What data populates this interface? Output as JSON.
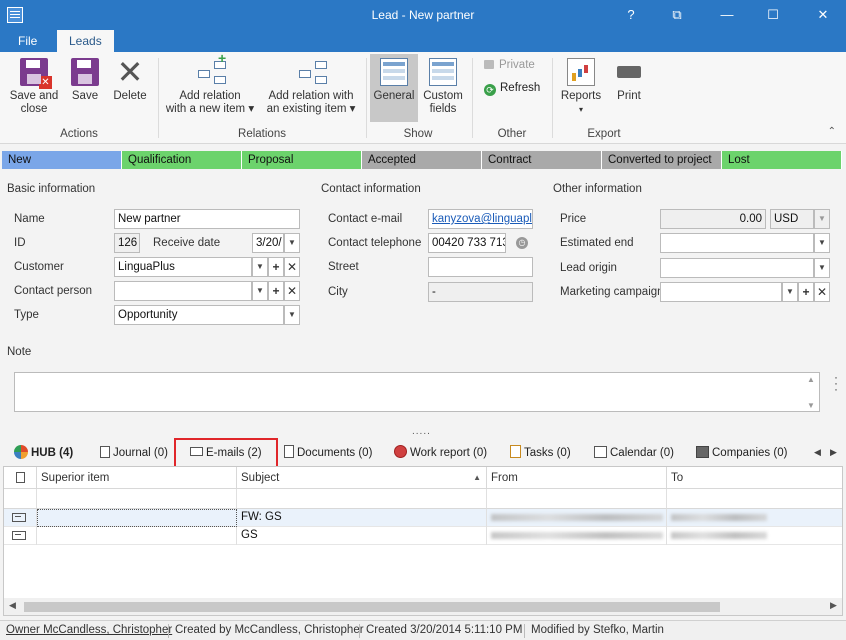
{
  "window": {
    "title": "Lead - New partner",
    "help": "?",
    "restore": "⧉",
    "minimize": "—",
    "maximize": "☐",
    "close": "✕"
  },
  "menu": {
    "file": "File",
    "leads": "Leads"
  },
  "ribbon": {
    "save_close": [
      "Save and",
      "close"
    ],
    "save": "Save",
    "delete": "Delete",
    "add_relation_new": [
      "Add relation",
      "with a new item ▾"
    ],
    "add_relation_existing": [
      "Add relation with",
      "an existing item ▾"
    ],
    "general": "General",
    "custom_fields": [
      "Custom",
      "fields"
    ],
    "private": "Private",
    "refresh": "Refresh",
    "reports": "Reports",
    "reports_arrow": "▾",
    "print": "Print",
    "groups": {
      "actions": "Actions",
      "relations": "Relations",
      "show": "Show",
      "other": "Other",
      "export": "Export"
    }
  },
  "stages": [
    {
      "label": "New",
      "color": "#7aa6e8"
    },
    {
      "label": "Qualification",
      "color": "#6cd36c"
    },
    {
      "label": "Proposal",
      "color": "#6cd36c"
    },
    {
      "label": "Accepted",
      "color": "#a9a9a9"
    },
    {
      "label": "Contract",
      "color": "#a9a9a9"
    },
    {
      "label": "Converted to project",
      "color": "#a9a9a9"
    },
    {
      "label": "Lost",
      "color": "#6cd36c"
    }
  ],
  "basic": {
    "title": "Basic information",
    "name_label": "Name",
    "name_value": "New partner",
    "id_label": "ID",
    "id_value": "126",
    "receive_date_label": "Receive date",
    "receive_date_value": "3/20/",
    "customer_label": "Customer",
    "customer_value": "LinguaPlus",
    "contact_person_label": "Contact person",
    "contact_person_value": "",
    "type_label": "Type",
    "type_value": "Opportunity"
  },
  "contact": {
    "title": "Contact information",
    "email_label": "Contact e-mail",
    "email_value": "kanyzova@linguaplu",
    "phone_label": "Contact telephone",
    "phone_value": "00420 733 713",
    "street_label": "Street",
    "street_value": "",
    "city_label": "City",
    "city_value": "-"
  },
  "other": {
    "title": "Other information",
    "price_label": "Price",
    "price_value": "0.00",
    "currency": "USD",
    "estimated_end_label": "Estimated end",
    "estimated_end_value": "",
    "lead_origin_label": "Lead origin",
    "lead_origin_value": "",
    "campaign_label": "Marketing campaign",
    "campaign_value": ""
  },
  "note": {
    "label": "Note",
    "value": ""
  },
  "splitter": ".....",
  "tabs": [
    {
      "label": "HUB (4)"
    },
    {
      "label": "Journal (0)"
    },
    {
      "label": "E-mails (2)"
    },
    {
      "label": "Documents (0)"
    },
    {
      "label": "Work report (0)"
    },
    {
      "label": "Tasks (0)"
    },
    {
      "label": "Calendar (0)"
    },
    {
      "label": "Companies (0)"
    }
  ],
  "grid": {
    "columns": [
      "Superior item",
      "Subject",
      "From",
      "To"
    ],
    "sort_indicator": "▲",
    "rows": [
      {
        "superior": "",
        "subject": "FW: GS"
      },
      {
        "superior": "",
        "subject": "GS"
      }
    ]
  },
  "statusbar": {
    "owner": "Owner McCandless, Christopher",
    "created_by": "Created by McCandless, Christopher",
    "created": "Created 3/20/2014 5:11:10 PM",
    "modified_by": "Modified by Stefko, Martin"
  }
}
